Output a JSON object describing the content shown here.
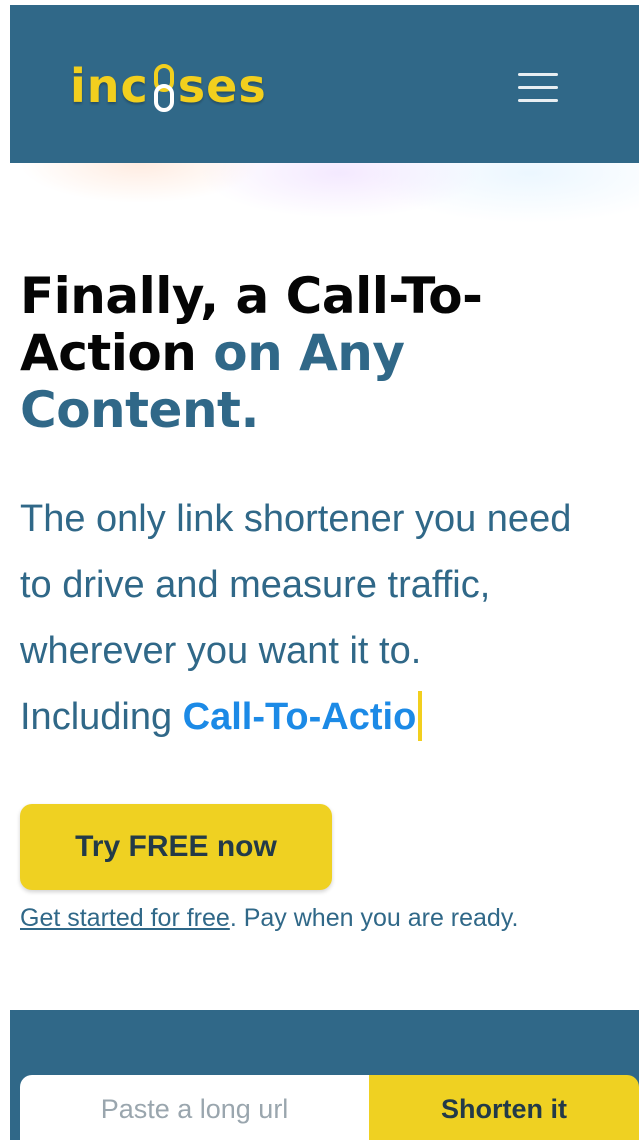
{
  "header": {
    "logo_text_start": "inc",
    "logo_text_end": "ses",
    "menu_icon": "hamburger-menu-icon"
  },
  "hero": {
    "title_part1": "Finally, a Call-To-",
    "title_part2": "Action ",
    "title_accent1": "on Any",
    "title_accent2": "Content.",
    "subtitle_line1": "The only link shortener you need",
    "subtitle_line2": "to drive and measure traffic,",
    "subtitle_line3": "wherever you want it to.",
    "subtitle_line4_prefix": "Including ",
    "typed_text": "Call-To-Actio"
  },
  "cta": {
    "button_label": "Try FREE now",
    "note_link": "Get started for free",
    "note_text": ". Pay when you are ready."
  },
  "shortener": {
    "input_placeholder": "Paste a long url",
    "button_label": "Shorten it"
  },
  "colors": {
    "brand_blue": "#306888",
    "brand_yellow": "#efd122",
    "typed_blue": "#1c8ae6"
  }
}
